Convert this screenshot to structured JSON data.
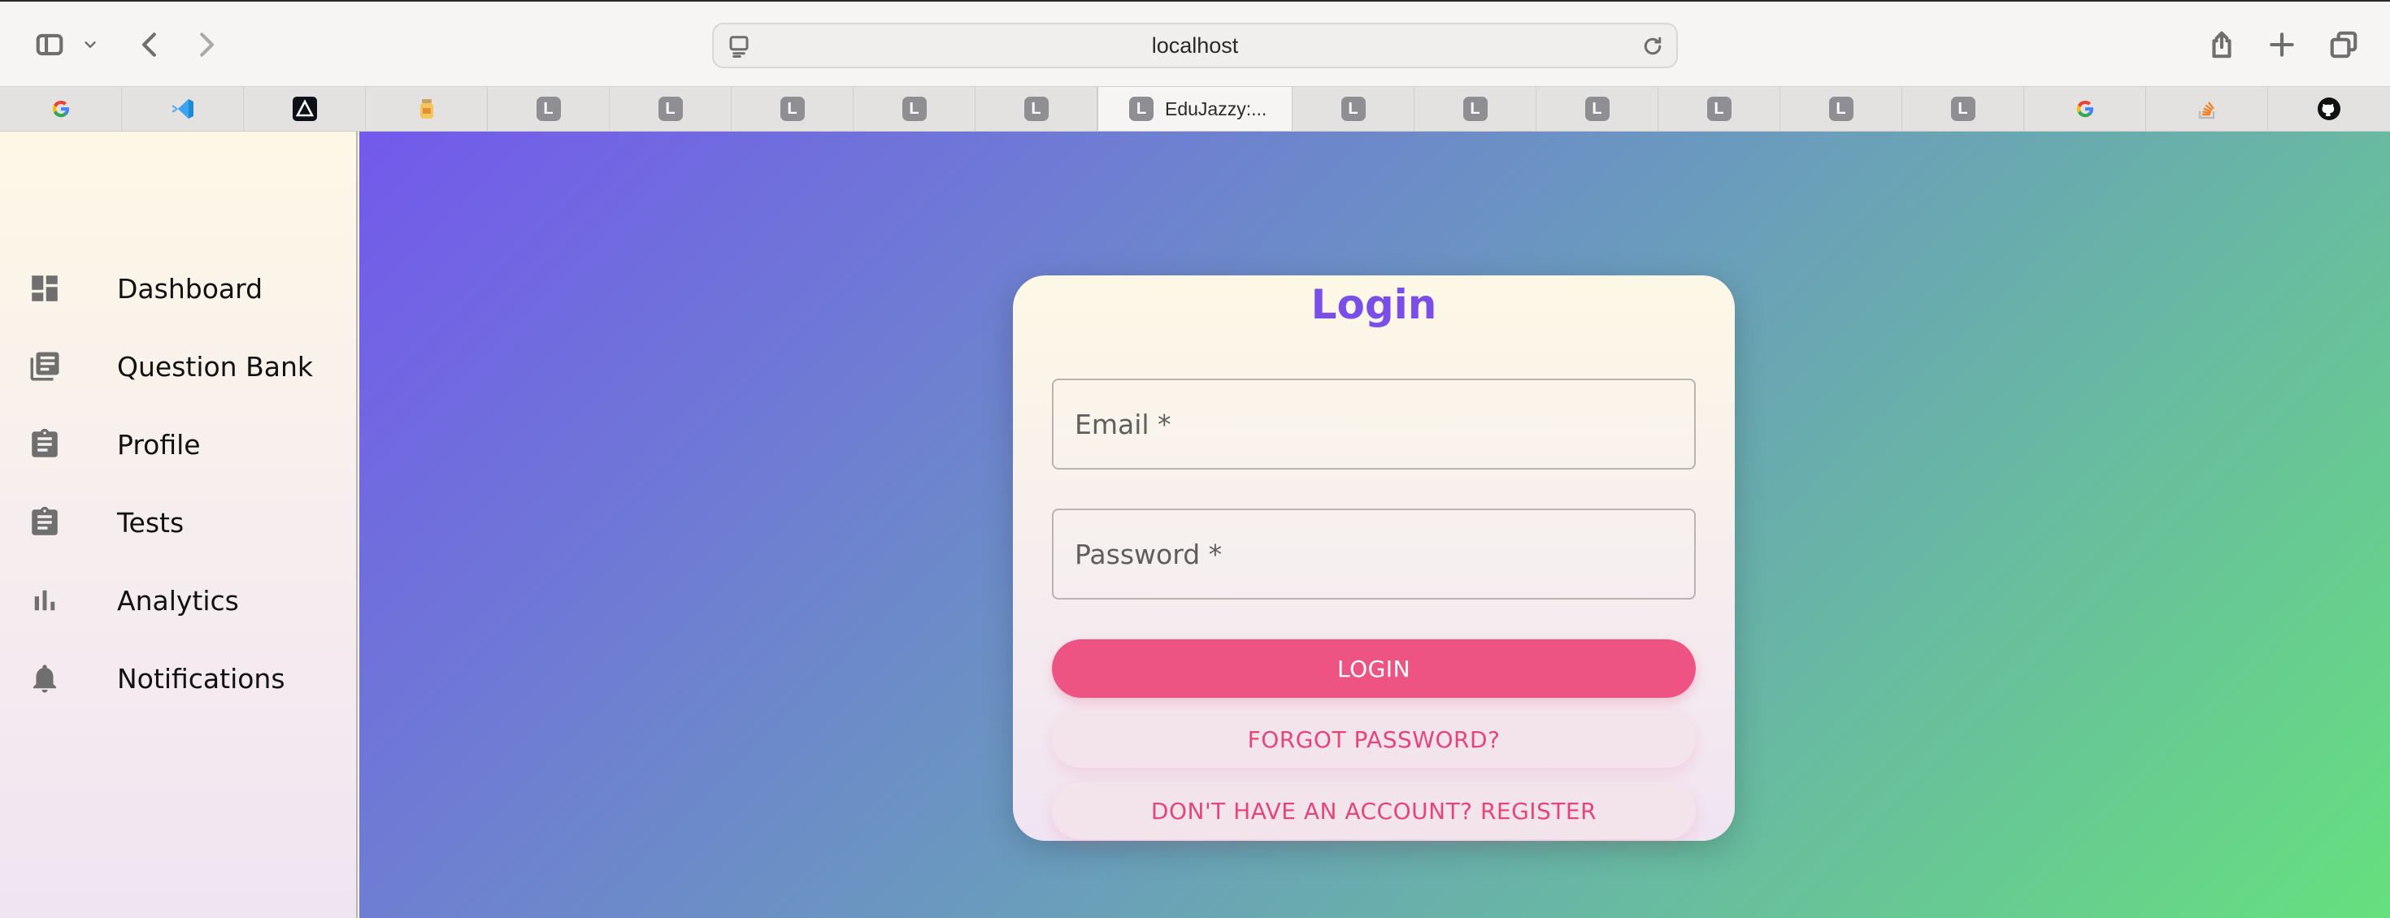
{
  "browser": {
    "url": "localhost",
    "icons": [
      "sidebar-icon",
      "chevron-down-icon",
      "back-icon",
      "forward-icon",
      "page-icon",
      "reload-icon",
      "share-icon",
      "new-tab-icon",
      "tab-overview-icon"
    ]
  },
  "tabs": [
    {
      "favicon": "google",
      "title": ""
    },
    {
      "favicon": "vscode",
      "title": ""
    },
    {
      "favicon": "dark-logo",
      "title": ""
    },
    {
      "favicon": "jar",
      "title": ""
    },
    {
      "favicon": "L",
      "title": ""
    },
    {
      "favicon": "L",
      "title": ""
    },
    {
      "favicon": "L",
      "title": ""
    },
    {
      "favicon": "L",
      "title": ""
    },
    {
      "favicon": "L",
      "title": ""
    },
    {
      "favicon": "L",
      "title": "EduJazzy:...",
      "active": true
    },
    {
      "favicon": "L",
      "title": ""
    },
    {
      "favicon": "L",
      "title": ""
    },
    {
      "favicon": "L",
      "title": ""
    },
    {
      "favicon": "L",
      "title": ""
    },
    {
      "favicon": "L",
      "title": ""
    },
    {
      "favicon": "L",
      "title": ""
    },
    {
      "favicon": "google",
      "title": ""
    },
    {
      "favicon": "stackoverflow",
      "title": ""
    },
    {
      "favicon": "github",
      "title": ""
    }
  ],
  "sidebar": {
    "items": [
      {
        "label": "Dashboard",
        "icon": "dashboard-icon"
      },
      {
        "label": "Question Bank",
        "icon": "library-icon"
      },
      {
        "label": "Profile",
        "icon": "clipboard-icon"
      },
      {
        "label": "Tests",
        "icon": "clipboard-icon"
      },
      {
        "label": "Analytics",
        "icon": "bar-chart-icon"
      },
      {
        "label": "Notifications",
        "icon": "bell-icon"
      }
    ]
  },
  "login": {
    "title": "Login",
    "email_placeholder": "Email *",
    "email_value": "",
    "password_placeholder": "Password *",
    "password_value": "",
    "login_button": "LOGIN",
    "forgot_button": "FORGOT PASSWORD?",
    "register_button": "DON'T HAVE AN ACCOUNT? REGISTER"
  },
  "colors": {
    "accent_primary": "#ed5483",
    "title_color": "#7a4fe8",
    "gradient_start": "#7359ec",
    "gradient_end": "#66e07e"
  }
}
